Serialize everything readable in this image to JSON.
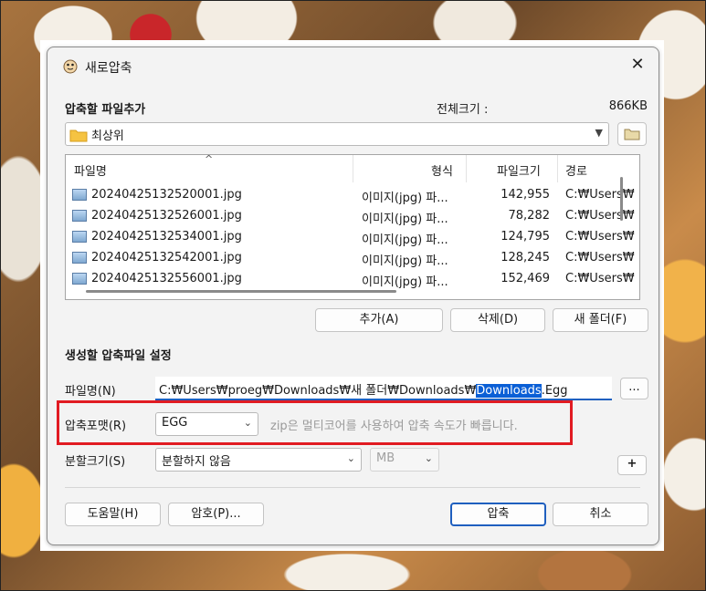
{
  "dialog": {
    "title": "새로압축",
    "close_glyph": "✕"
  },
  "add_section": {
    "heading": "압축할 파일추가",
    "total_size_label": "전체크기 :",
    "total_size_value": "866KB",
    "folder_combo_value": "최상위"
  },
  "file_list": {
    "sort_glyph": "^",
    "columns": [
      "파일명",
      "형식",
      "파일크기",
      "경로"
    ],
    "rows": [
      {
        "name": "20240425132520001.jpg",
        "type": "이미지(jpg) 파...",
        "size": "142,955",
        "path": "C:₩Users₩"
      },
      {
        "name": "20240425132526001.jpg",
        "type": "이미지(jpg) 파...",
        "size": "78,282",
        "path": "C:₩Users₩"
      },
      {
        "name": "20240425132534001.jpg",
        "type": "이미지(jpg) 파...",
        "size": "124,795",
        "path": "C:₩Users₩"
      },
      {
        "name": "20240425132542001.jpg",
        "type": "이미지(jpg) 파...",
        "size": "128,245",
        "path": "C:₩Users₩"
      },
      {
        "name": "20240425132556001.jpg",
        "type": "이미지(jpg) 파...",
        "size": "152,469",
        "path": "C:₩Users₩"
      }
    ]
  },
  "list_buttons": {
    "add": "추가(A)",
    "delete": "삭제(D)",
    "new_folder": "새 폴더(F)"
  },
  "settings": {
    "heading": "생성할 압축파일 설정",
    "filename_label": "파일명(N)",
    "filename_prefix": "C:₩Users₩proeg₩Downloads₩새 폴더₩Downloads₩",
    "filename_selected": "Downloads",
    "filename_suffix": ".Egg",
    "browse_label": "...",
    "format_label": "압축포맷(R)",
    "format_value": "EGG",
    "format_hint": "zip은 멀티코어를 사용하여 압축 속도가 빠릅니다.",
    "split_label": "분할크기(S)",
    "split_value": "분할하지 않음",
    "split_unit": "MB",
    "plus_label": "+"
  },
  "footer": {
    "help": "도움말(H)",
    "password": "암호(P)...",
    "compress": "압축",
    "cancel": "취소"
  },
  "colors": {
    "accent": "#1f5fbf",
    "highlight_box": "#e11b22",
    "selection": "#0a5fd6"
  }
}
